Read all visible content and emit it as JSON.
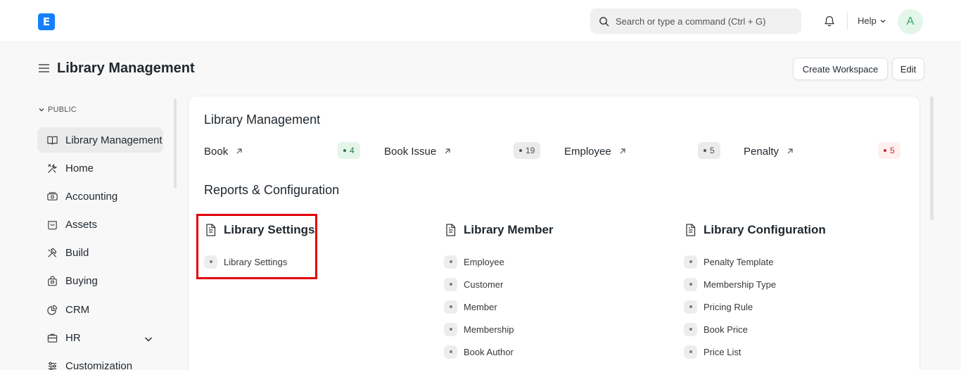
{
  "navbar": {
    "logo_letter": "E",
    "search_placeholder": "Search or type a command (Ctrl + G)",
    "help_label": "Help",
    "avatar_initial": "A"
  },
  "page": {
    "title": "Library Management",
    "create_workspace_label": "Create Workspace",
    "edit_label": "Edit"
  },
  "sidebar": {
    "section_label": "PUBLIC",
    "items": [
      {
        "label": "Library Management",
        "icon": "book-icon"
      },
      {
        "label": "Home",
        "icon": "tools-icon"
      },
      {
        "label": "Accounting",
        "icon": "money-icon"
      },
      {
        "label": "Assets",
        "icon": "box-icon"
      },
      {
        "label": "Build",
        "icon": "hammer-icon"
      },
      {
        "label": "Buying",
        "icon": "bag-icon"
      },
      {
        "label": "CRM",
        "icon": "pie-icon"
      },
      {
        "label": "HR",
        "icon": "briefcase-icon"
      },
      {
        "label": "Customization",
        "icon": "sliders-icon"
      }
    ]
  },
  "main": {
    "heading": "Library Management",
    "shortcuts": [
      {
        "label": "Book",
        "count": "4",
        "color": "green"
      },
      {
        "label": "Book Issue",
        "count": "19",
        "color": "gray"
      },
      {
        "label": "Employee",
        "count": "5",
        "color": "gray"
      },
      {
        "label": "Penalty",
        "count": "5",
        "color": "red"
      }
    ],
    "reports_heading": "Reports & Configuration",
    "cards": [
      {
        "title": "Library Settings",
        "links": [
          "Library Settings"
        ]
      },
      {
        "title": "Library Member",
        "links": [
          "Employee",
          "Customer",
          "Member",
          "Membership",
          "Book Author"
        ]
      },
      {
        "title": "Library Configuration",
        "links": [
          "Penalty Template",
          "Membership Type",
          "Pricing Rule",
          "Book Price",
          "Price List"
        ]
      }
    ]
  },
  "colors": {
    "accent": "#1580ff",
    "highlight": "#e3000f",
    "badge_green": "#e4f5e9",
    "badge_red": "#fff0f0"
  }
}
